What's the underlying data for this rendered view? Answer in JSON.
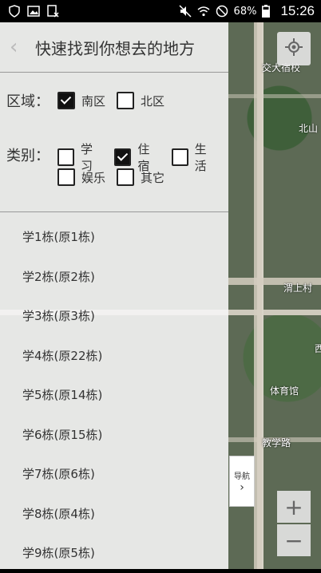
{
  "status": {
    "battery": "68%",
    "time": "15:26"
  },
  "header": {
    "title": "快速找到你想去的地方"
  },
  "area": {
    "label": "区域：",
    "options": [
      {
        "label": "南区",
        "checked": true
      },
      {
        "label": "北区",
        "checked": false
      }
    ]
  },
  "category": {
    "label": "类别：",
    "options": [
      {
        "label": "学习",
        "checked": false
      },
      {
        "label": "住宿",
        "checked": true
      },
      {
        "label": "生活",
        "checked": false
      },
      {
        "label": "娱乐",
        "checked": false
      },
      {
        "label": "其它",
        "checked": false
      }
    ]
  },
  "buildings": [
    "学1栋(原1栋)",
    "学2栋(原2栋)",
    "学3栋(原3栋)",
    "学4栋(原22栋)",
    "学5栋(原14栋)",
    "学6栋(原15栋)",
    "学7栋(原6栋)",
    "学8栋(原4栋)",
    "学9栋(原5栋)"
  ],
  "map": {
    "nav_label": "导航",
    "zoom_in": "+",
    "zoom_out": "−",
    "labels": [
      "交大宿校",
      "北山",
      "西",
      "渭上村",
      "体育馆",
      "教学路"
    ]
  }
}
